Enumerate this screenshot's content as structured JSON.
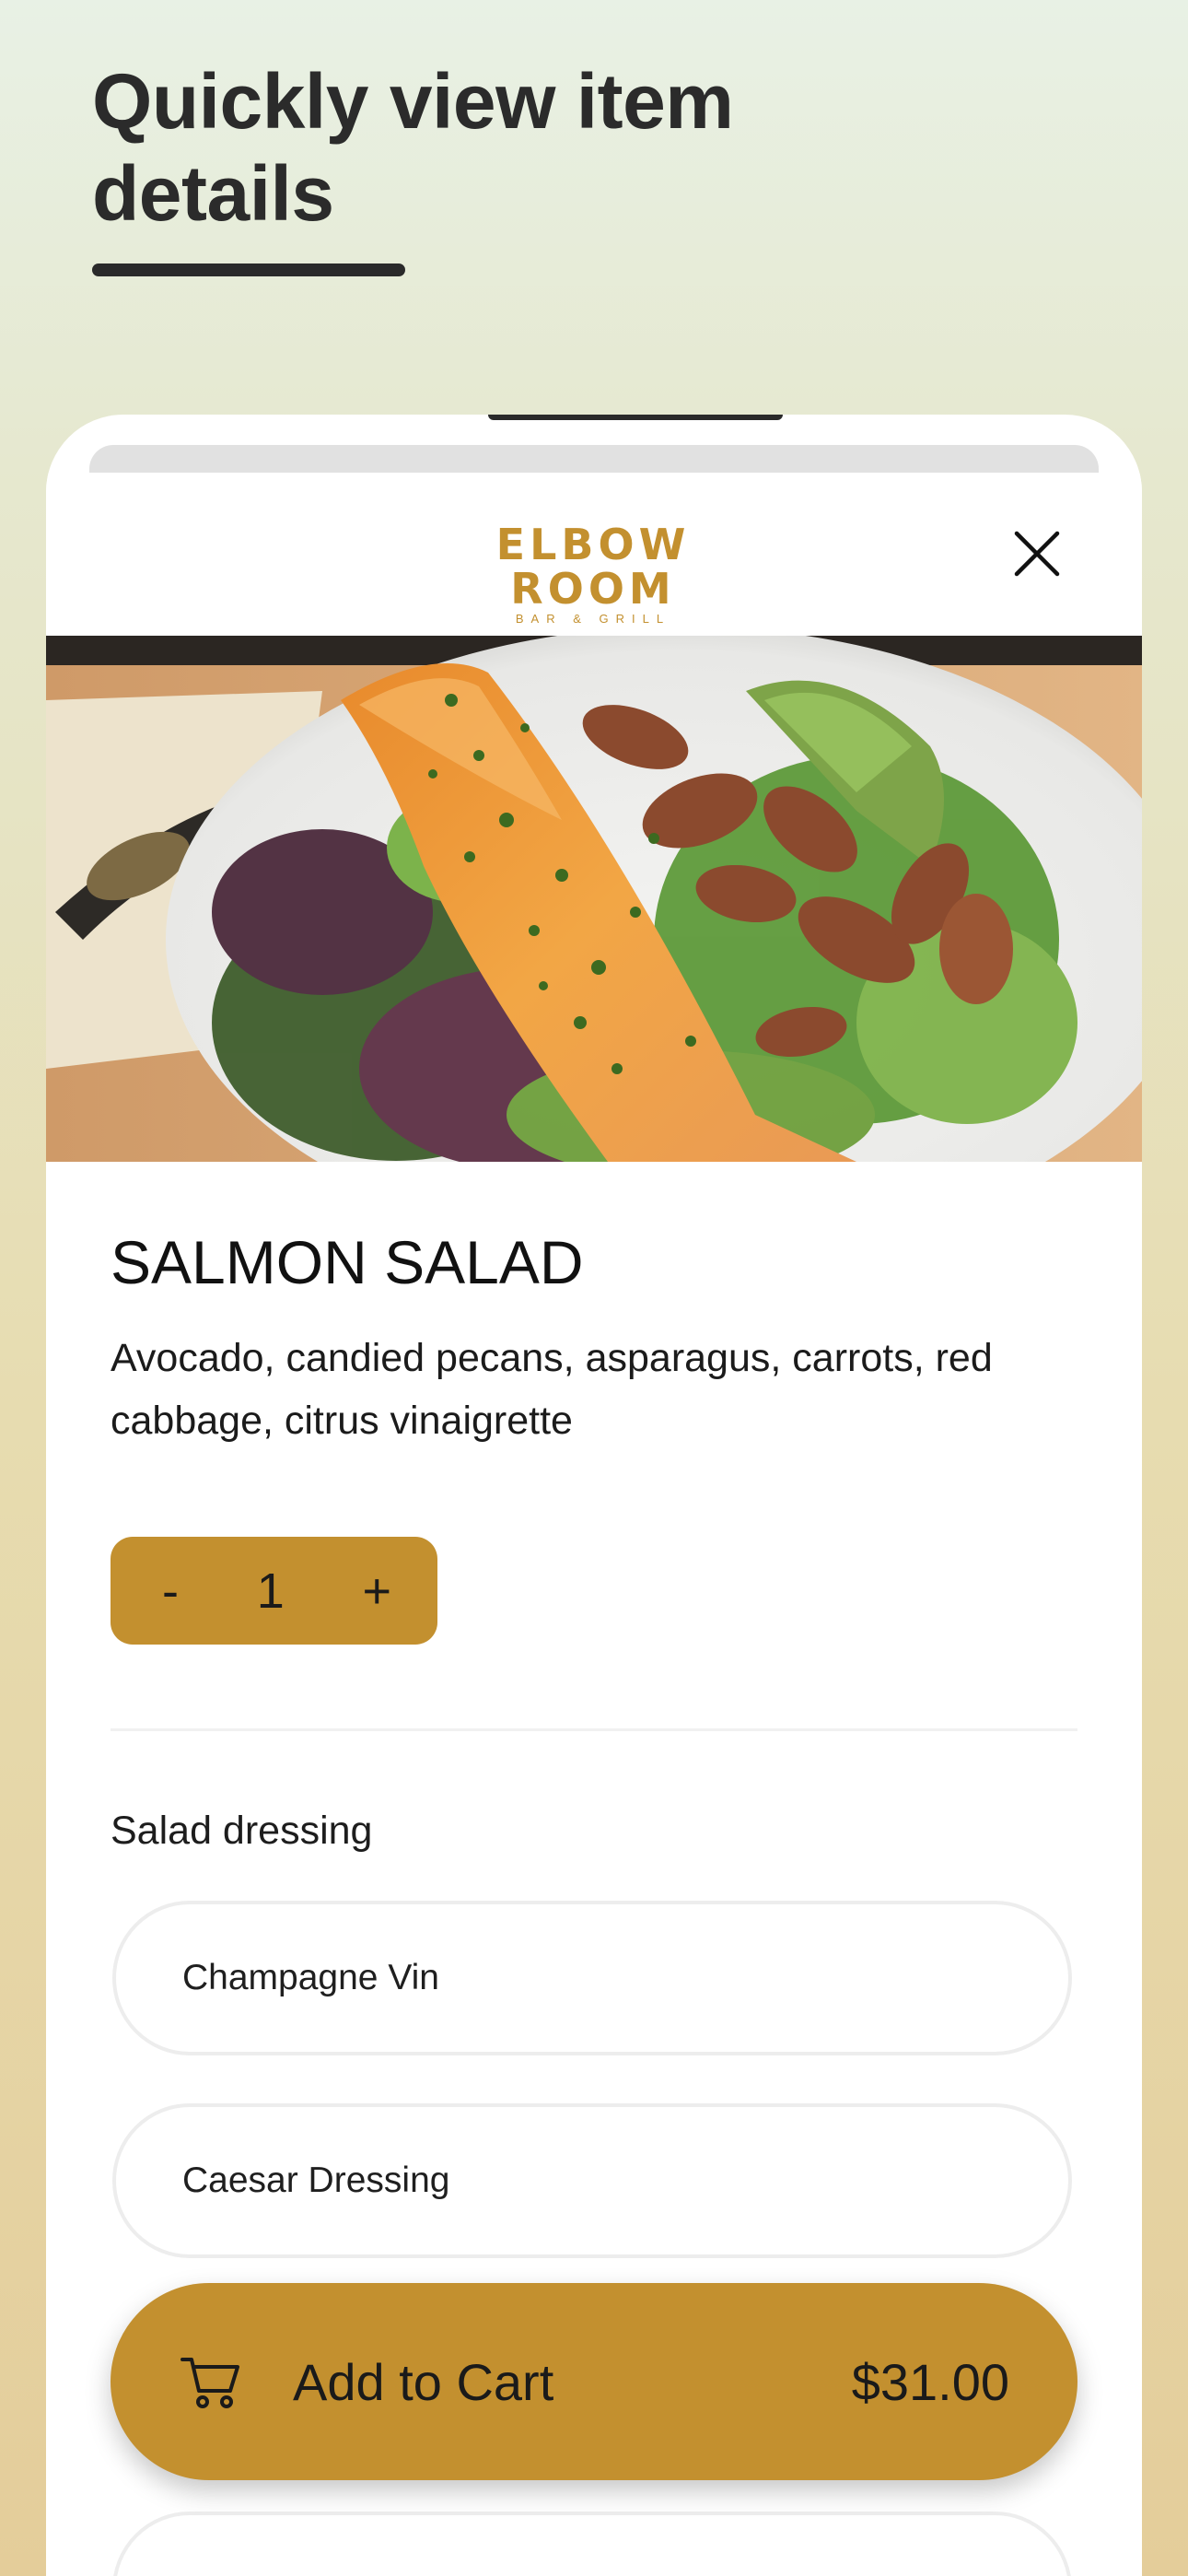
{
  "headline": {
    "text": "Quickly view item details"
  },
  "brand": {
    "name": "ELBOW ROOM",
    "tagline": "BAR & GRILL",
    "accent_color": "#c3902f"
  },
  "item": {
    "name": "SALMON SALAD",
    "description": "Avocado, candied pecans, asparagus, carrots, red cabbage, citrus vinaigrette",
    "quantity": "1",
    "decrement_label": "-",
    "increment_label": "+"
  },
  "options": {
    "section_title": "Salad dressing",
    "choices": [
      "Champagne Vin",
      "Caesar Dressing"
    ]
  },
  "cart": {
    "label": "Add to Cart",
    "price": "$31.00",
    "icon": "cart-icon"
  },
  "icons": {
    "close": "close-icon"
  }
}
